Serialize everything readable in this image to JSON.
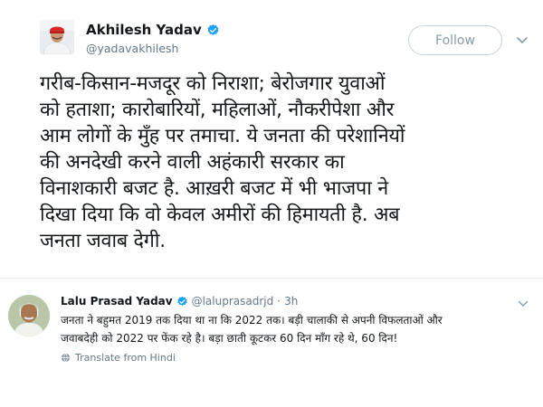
{
  "tweet": {
    "author": {
      "display_name": "Akhilesh Yadav",
      "handle": "@yadavakhilesh",
      "verified": true,
      "avatar_icon": "profile-photo-man-red-cap"
    },
    "follow_label": "Follow",
    "text_lines": [
      "गरीब-किसान-मजदूर को निराशा; बेरोजगार युवाओं",
      "को हताशा; कारोबारियों, महिलाओं, नौकरीपेशा और",
      "आम लोगों के मुँह पर तमाचा. ये जनता की परेशानियों",
      "की अनदेखी करने वाली अहंकारी सरकार का",
      "विनाशकारी बजट है. आख़री बजट में भी भाजपा ने",
      "दिखा दिया कि वो केवल अमीरों की हिमायती है. अब",
      "जनता जवाब देगी."
    ]
  },
  "reply": {
    "author": {
      "display_name": "Lalu Prasad Yadav",
      "handle": "@laluprasadrjd",
      "verified": true,
      "avatar_icon": "profile-photo-man-white-hair"
    },
    "separator": "·",
    "time": "3h",
    "text_lines": [
      "जनता ने बहुमत 2019 तक दिया था ना कि 2022 तक। बड़ी चालाकी से अपनी विफलताओं और",
      "जवाबदेही को 2022 पर फेंक रहे है। बड़ा छाती कूटकर 60 दिन माँग रहे थे, 60 दिन!"
    ],
    "translate_label": "Translate from Hindi"
  },
  "colors": {
    "text": "#14171a",
    "secondary": "#657786",
    "verified": "#1da1f2",
    "border": "#e6ecf0"
  }
}
